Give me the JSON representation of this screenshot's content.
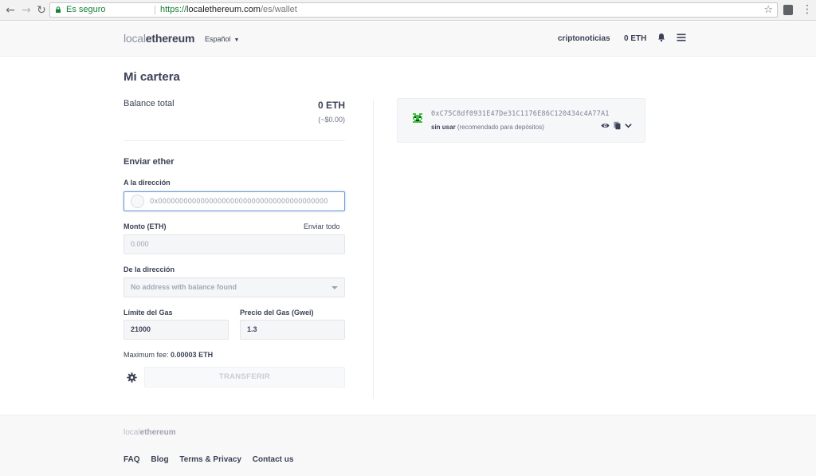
{
  "browser": {
    "secure_label": "Es seguro",
    "url_proto": "https://",
    "url_host": "localethereum.com",
    "url_path": "/es/wallet"
  },
  "header": {
    "logo_light": "local",
    "logo_bold": "ethereum",
    "language": "Español",
    "username": "criptonoticias",
    "balance": "0 ETH"
  },
  "main": {
    "title": "Mi cartera",
    "balance_label": "Balance total",
    "balance_eth": "0 ETH",
    "balance_usd": "(~$0.00)",
    "send_title": "Enviar ether",
    "to_label": "A la dirección",
    "to_placeholder": "0x0000000000000000000000000000000000000000",
    "amount_label": "Monto (ETH)",
    "send_all": "Enviar todo",
    "amount_placeholder": "0.000",
    "from_label": "De la dirección",
    "from_value": "No address with balance found",
    "gas_limit_label": "Límite del Gas",
    "gas_limit_value": "21000",
    "gas_price_label": "Precio del Gas (Gwei)",
    "gas_price_value": "1.3",
    "max_fee_label": "Maximum fee:",
    "max_fee_value": "0.00003 ETH",
    "transfer_button": "TRANSFERIR"
  },
  "wallet": {
    "address": "0xC75C8df0931E47De31C1176E86C120434c4A77A1",
    "status_bold": "sin usar",
    "status_note": "(recomendado para depósitos)"
  },
  "footer": {
    "logo_light": "local",
    "logo_bold": "ethereum",
    "links": [
      "FAQ",
      "Blog",
      "Terms & Privacy",
      "Contact us"
    ]
  },
  "colors": {
    "text": "#3b4256",
    "accent_focus": "#6e9bd4",
    "secure_green": "#188038",
    "identicon_green": "#3fc241"
  }
}
